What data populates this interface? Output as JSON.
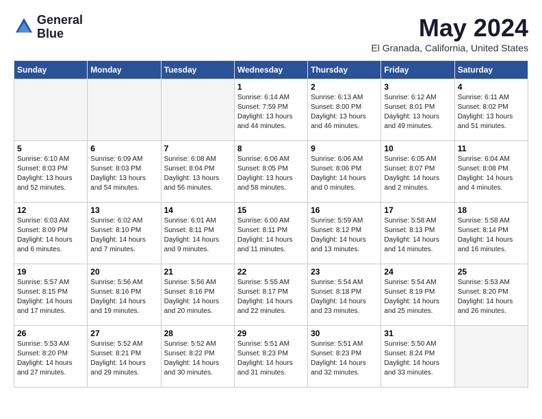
{
  "header": {
    "logo_line1": "General",
    "logo_line2": "Blue",
    "month_title": "May 2024",
    "location": "El Granada, California, United States"
  },
  "weekdays": [
    "Sunday",
    "Monday",
    "Tuesday",
    "Wednesday",
    "Thursday",
    "Friday",
    "Saturday"
  ],
  "weeks": [
    [
      {
        "day": "",
        "info": ""
      },
      {
        "day": "",
        "info": ""
      },
      {
        "day": "",
        "info": ""
      },
      {
        "day": "1",
        "info": "Sunrise: 6:14 AM\nSunset: 7:59 PM\nDaylight: 13 hours\nand 44 minutes."
      },
      {
        "day": "2",
        "info": "Sunrise: 6:13 AM\nSunset: 8:00 PM\nDaylight: 13 hours\nand 46 minutes."
      },
      {
        "day": "3",
        "info": "Sunrise: 6:12 AM\nSunset: 8:01 PM\nDaylight: 13 hours\nand 49 minutes."
      },
      {
        "day": "4",
        "info": "Sunrise: 6:11 AM\nSunset: 8:02 PM\nDaylight: 13 hours\nand 51 minutes."
      }
    ],
    [
      {
        "day": "5",
        "info": "Sunrise: 6:10 AM\nSunset: 8:03 PM\nDaylight: 13 hours\nand 52 minutes."
      },
      {
        "day": "6",
        "info": "Sunrise: 6:09 AM\nSunset: 8:03 PM\nDaylight: 13 hours\nand 54 minutes."
      },
      {
        "day": "7",
        "info": "Sunrise: 6:08 AM\nSunset: 8:04 PM\nDaylight: 13 hours\nand 56 minutes."
      },
      {
        "day": "8",
        "info": "Sunrise: 6:06 AM\nSunset: 8:05 PM\nDaylight: 13 hours\nand 58 minutes."
      },
      {
        "day": "9",
        "info": "Sunrise: 6:06 AM\nSunset: 8:06 PM\nDaylight: 14 hours\nand 0 minutes."
      },
      {
        "day": "10",
        "info": "Sunrise: 6:05 AM\nSunset: 8:07 PM\nDaylight: 14 hours\nand 2 minutes."
      },
      {
        "day": "11",
        "info": "Sunrise: 6:04 AM\nSunset: 8:08 PM\nDaylight: 14 hours\nand 4 minutes."
      }
    ],
    [
      {
        "day": "12",
        "info": "Sunrise: 6:03 AM\nSunset: 8:09 PM\nDaylight: 14 hours\nand 6 minutes."
      },
      {
        "day": "13",
        "info": "Sunrise: 6:02 AM\nSunset: 8:10 PM\nDaylight: 14 hours\nand 7 minutes."
      },
      {
        "day": "14",
        "info": "Sunrise: 6:01 AM\nSunset: 8:11 PM\nDaylight: 14 hours\nand 9 minutes."
      },
      {
        "day": "15",
        "info": "Sunrise: 6:00 AM\nSunset: 8:11 PM\nDaylight: 14 hours\nand 11 minutes."
      },
      {
        "day": "16",
        "info": "Sunrise: 5:59 AM\nSunset: 8:12 PM\nDaylight: 14 hours\nand 13 minutes."
      },
      {
        "day": "17",
        "info": "Sunrise: 5:58 AM\nSunset: 8:13 PM\nDaylight: 14 hours\nand 14 minutes."
      },
      {
        "day": "18",
        "info": "Sunrise: 5:58 AM\nSunset: 8:14 PM\nDaylight: 14 hours\nand 16 minutes."
      }
    ],
    [
      {
        "day": "19",
        "info": "Sunrise: 5:57 AM\nSunset: 8:15 PM\nDaylight: 14 hours\nand 17 minutes."
      },
      {
        "day": "20",
        "info": "Sunrise: 5:56 AM\nSunset: 8:16 PM\nDaylight: 14 hours\nand 19 minutes."
      },
      {
        "day": "21",
        "info": "Sunrise: 5:56 AM\nSunset: 8:16 PM\nDaylight: 14 hours\nand 20 minutes."
      },
      {
        "day": "22",
        "info": "Sunrise: 5:55 AM\nSunset: 8:17 PM\nDaylight: 14 hours\nand 22 minutes."
      },
      {
        "day": "23",
        "info": "Sunrise: 5:54 AM\nSunset: 8:18 PM\nDaylight: 14 hours\nand 23 minutes."
      },
      {
        "day": "24",
        "info": "Sunrise: 5:54 AM\nSunset: 8:19 PM\nDaylight: 14 hours\nand 25 minutes."
      },
      {
        "day": "25",
        "info": "Sunrise: 5:53 AM\nSunset: 8:20 PM\nDaylight: 14 hours\nand 26 minutes."
      }
    ],
    [
      {
        "day": "26",
        "info": "Sunrise: 5:53 AM\nSunset: 8:20 PM\nDaylight: 14 hours\nand 27 minutes."
      },
      {
        "day": "27",
        "info": "Sunrise: 5:52 AM\nSunset: 8:21 PM\nDaylight: 14 hours\nand 29 minutes."
      },
      {
        "day": "28",
        "info": "Sunrise: 5:52 AM\nSunset: 8:22 PM\nDaylight: 14 hours\nand 30 minutes."
      },
      {
        "day": "29",
        "info": "Sunrise: 5:51 AM\nSunset: 8:23 PM\nDaylight: 14 hours\nand 31 minutes."
      },
      {
        "day": "30",
        "info": "Sunrise: 5:51 AM\nSunset: 8:23 PM\nDaylight: 14 hours\nand 32 minutes."
      },
      {
        "day": "31",
        "info": "Sunrise: 5:50 AM\nSunset: 8:24 PM\nDaylight: 14 hours\nand 33 minutes."
      },
      {
        "day": "",
        "info": ""
      }
    ]
  ]
}
